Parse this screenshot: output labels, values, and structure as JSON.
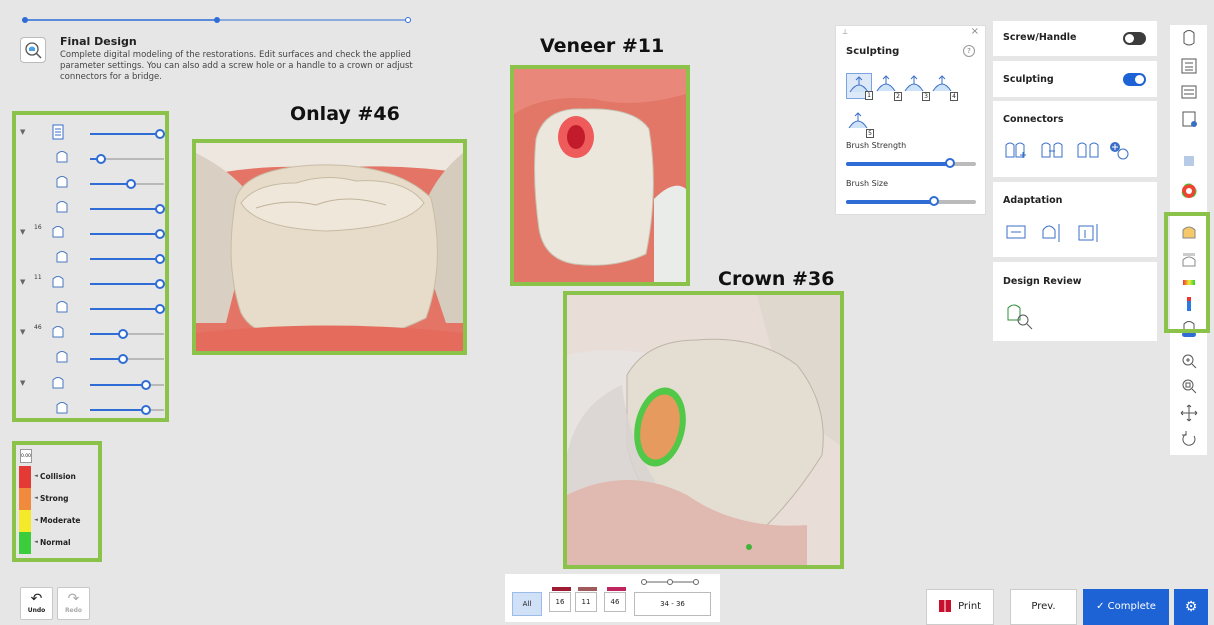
{
  "header": {
    "title": "Final Design",
    "description": "Complete digital modeling of the restorations. Edit surfaces and check the applied parameter settings. You can also add a screw hole or a handle to a crown or adjust connectors for a bridge."
  },
  "layers": [
    {
      "num": "",
      "value": 0.95
    },
    {
      "num": "",
      "value": 0.15
    },
    {
      "num": "",
      "value": 0.55
    },
    {
      "num": "",
      "value": 0.95
    },
    {
      "num": "16",
      "value": 0.95
    },
    {
      "num": "",
      "value": 0.95
    },
    {
      "num": "11",
      "value": 0.95
    },
    {
      "num": "",
      "value": 0.95
    },
    {
      "num": "46",
      "value": 0.45
    },
    {
      "num": "",
      "value": 0.45
    },
    {
      "num": "",
      "value": 0.75
    },
    {
      "num": "",
      "value": 0.75
    }
  ],
  "legend": {
    "value": "0.00",
    "items": [
      {
        "label": "Collision",
        "color": "#e53935"
      },
      {
        "label": "Strong",
        "color": "#f08a3c"
      },
      {
        "label": "Moderate",
        "color": "#f4ea2a"
      },
      {
        "label": "Normal",
        "color": "#3ccd3c"
      }
    ]
  },
  "captions": {
    "onlay": "Onlay #46",
    "veneer": "Veneer #11",
    "crown": "Crown #36"
  },
  "undo": {
    "label": "Undo"
  },
  "redo": {
    "label": "Redo"
  },
  "tooth_tabs": {
    "all": "All",
    "t16": "16",
    "t11": "11",
    "t46": "46",
    "range": "34 - 36",
    "colors": [
      "#9e1b32",
      "#a05a5a",
      "#c0245c"
    ]
  },
  "sculpting_popup": {
    "title": "Sculpting",
    "help": "?",
    "tools": [
      "1",
      "2",
      "3",
      "4",
      "5"
    ],
    "strength_label": "Brush Strength",
    "strength": 0.8,
    "size_label": "Brush Size",
    "size": 0.68
  },
  "cards": {
    "screw": {
      "title": "Screw/Handle",
      "on": false
    },
    "sculpt": {
      "title": "Sculpting",
      "on": true
    },
    "connectors": {
      "title": "Connectors"
    },
    "adaptation": {
      "title": "Adaptation"
    },
    "review": {
      "title": "Design Review"
    }
  },
  "footer": {
    "print": "Print",
    "prev": "Prev.",
    "complete": "✓ Complete"
  },
  "colors": {
    "accent": "#2f6cd6",
    "highlight": "#8bc34a",
    "primary_btn": "#1e63d6"
  }
}
